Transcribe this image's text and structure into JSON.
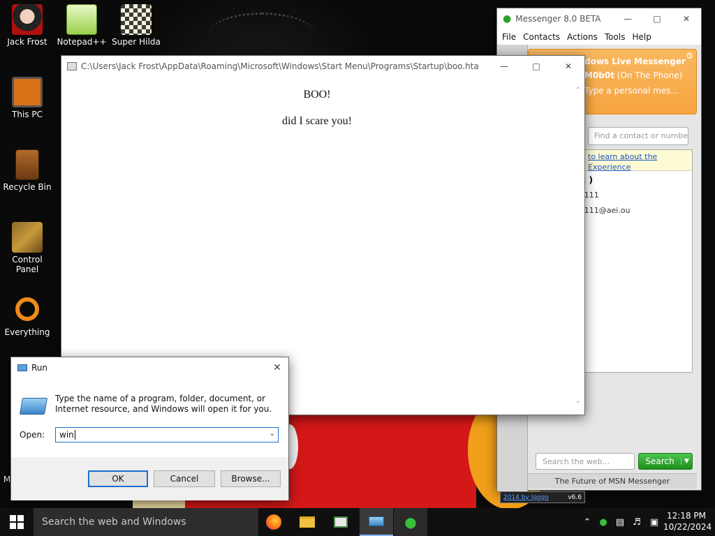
{
  "desktop": {
    "icons": [
      {
        "label": "Jack Frost"
      },
      {
        "label": "Notepad++"
      },
      {
        "label": "Super Hilda"
      },
      {
        "label": "This PC"
      },
      {
        "label": "Recycle Bin"
      },
      {
        "label": "Control Panel"
      },
      {
        "label": "Everything"
      }
    ],
    "partial_icon_label": "M"
  },
  "hta_window": {
    "title": "C:\\Users\\Jack Frost\\AppData\\Roaming\\Microsoft\\Windows\\Start Menu\\Programs\\Startup\\boo.hta",
    "heading": "BOO!",
    "message": "did I scare you!"
  },
  "messenger": {
    "title": "Messenger 8.0 BETA",
    "menu": [
      "File",
      "Contacts",
      "Actions",
      "Tools",
      "Help"
    ],
    "header_title": "dows Live Messenger",
    "username": "M0b0t",
    "status": "(On The Phone)",
    "personal_message": "Type a personal mes...",
    "find_placeholder": "Find a contact or numbe",
    "ad_line1": "to learn about the",
    "ad_line2": "Experience",
    "group": "2 )",
    "contact_name": "s111",
    "contact_email": "s111@aei.ou",
    "search_placeholder": "Search the web...",
    "search_button": "Search",
    "footer": "The Future of MSN Messenger",
    "credit_link": "2014 by Igogo",
    "credit_version": "v6.6"
  },
  "run_dialog": {
    "title": "Run",
    "description": "Type the name of a program, folder, document, or Internet resource, and Windows will open it for you.",
    "open_label": "Open:",
    "input_value": "win",
    "ok_label": "OK",
    "cancel_label": "Cancel",
    "browse_label": "Browse..."
  },
  "taskbar": {
    "search_text": "Search the web and Windows",
    "time": "12:18 PM",
    "date": "10/22/2024"
  },
  "colors": {
    "msn_orange": "#f7a440",
    "msn_green": "#1f8f1f",
    "focus_blue": "#1a6fd0",
    "taskbar": "#101010"
  }
}
